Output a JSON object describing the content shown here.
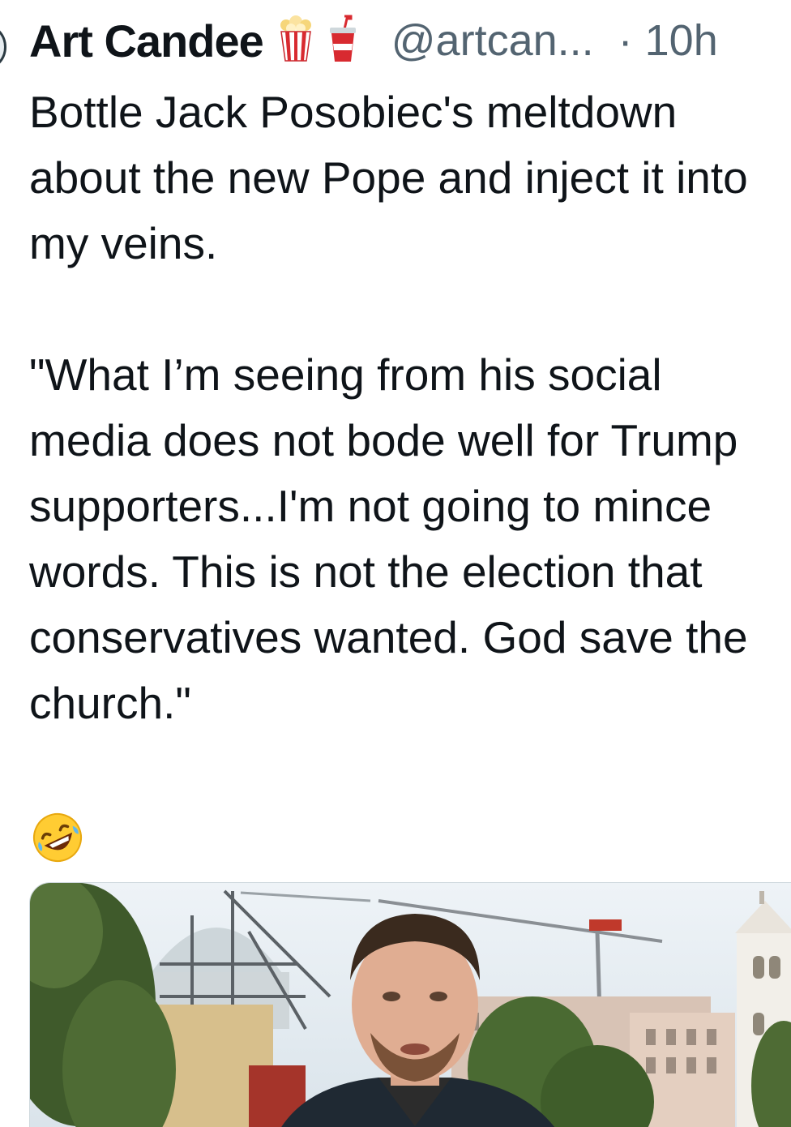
{
  "tweet": {
    "author": {
      "display_name": "Art Candee",
      "name_emojis": [
        "popcorn-icon",
        "soda-cup-icon"
      ],
      "handle": "@artcan...",
      "time": "· 10h"
    },
    "text": {
      "line1": "Bottle Jack Posobiec's meltdown about the new Pope and inject it into my veins.",
      "line2": "\"What I’m seeing from his social media does not bode well for Trump supporters...I'm not going to mince words. This is not the election that conservatives wanted. God save the church.\""
    },
    "reaction_emoji": "rolling-on-floor-laughing-icon",
    "media": {
      "kind": "video-thumbnail",
      "depicts": [
        "man-in-dark-jacket",
        "trees",
        "building",
        "construction-crane",
        "bell-tower"
      ]
    }
  },
  "colors": {
    "text_primary": "#0f1419",
    "text_secondary": "#536471",
    "background": "#ffffff",
    "media_border": "#cfd9de"
  }
}
